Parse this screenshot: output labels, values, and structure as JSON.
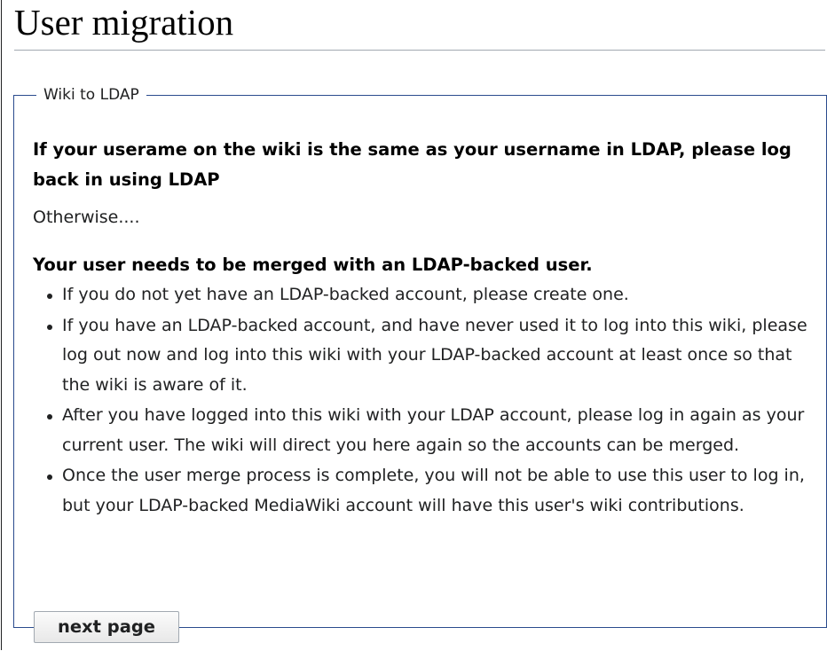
{
  "page": {
    "title": "User migration"
  },
  "form": {
    "legend": "Wiki to LDAP",
    "intro_bold": "If your userame on the wiki is the same as your username in LDAP, please log back in using LDAP",
    "otherwise": "Otherwise....",
    "merge_heading": "Your user needs to be merged with an LDAP-backed user.",
    "steps": [
      "If you do not yet have an LDAP-backed account, please create one.",
      "If you have an LDAP-backed account, and have never used it to log into this wiki, please log out now and log into this wiki with your LDAP-backed account at least once so that the wiki is aware of it.",
      "After you have logged into this wiki with your LDAP account, please log in again as your current user. The wiki will direct you here again so the accounts can be merged.",
      "Once the user merge process is complete, you will not be able to use this user to log in, but your LDAP-backed MediaWiki account will have this user's wiki contributions."
    ],
    "next_button": "next page"
  }
}
